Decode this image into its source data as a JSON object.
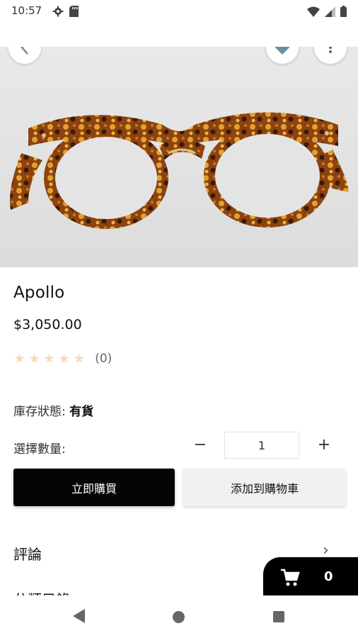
{
  "status_bar": {
    "time": "10:57",
    "left_icons": [
      "gear-icon",
      "sd-card-icon"
    ],
    "right_icons": [
      "wifi-icon",
      "signal-icon",
      "battery-icon"
    ]
  },
  "header": {
    "back_icon": "chevron-left-icon",
    "favorite_icon": "heart-icon",
    "more_icon": "more-vertical-icon"
  },
  "product": {
    "image": "tortoiseshell-eyeglasses",
    "title": "Apollo",
    "price": "$3,050.00",
    "rating_count": "(0)",
    "rating_value": 0,
    "rating_max": 5,
    "stock_label": "庫存狀態:",
    "stock_value": "有貨",
    "quantity_label": "選擇數量:",
    "quantity_value": "1",
    "minus_label": "−",
    "plus_label": "+"
  },
  "actions": {
    "buy_now": "立即購買",
    "add_to_cart": "添加到購物車"
  },
  "sections": {
    "reviews": "評論",
    "reviews_chevron": "›",
    "next": "分類目錄"
  },
  "cart": {
    "count": "0",
    "icon": "shopping-cart-icon"
  },
  "colors": {
    "primary_button": "#050505",
    "secondary_button": "#f0f1f3",
    "heart": "#6b8ea3",
    "star_empty": "#f6dcbd"
  }
}
